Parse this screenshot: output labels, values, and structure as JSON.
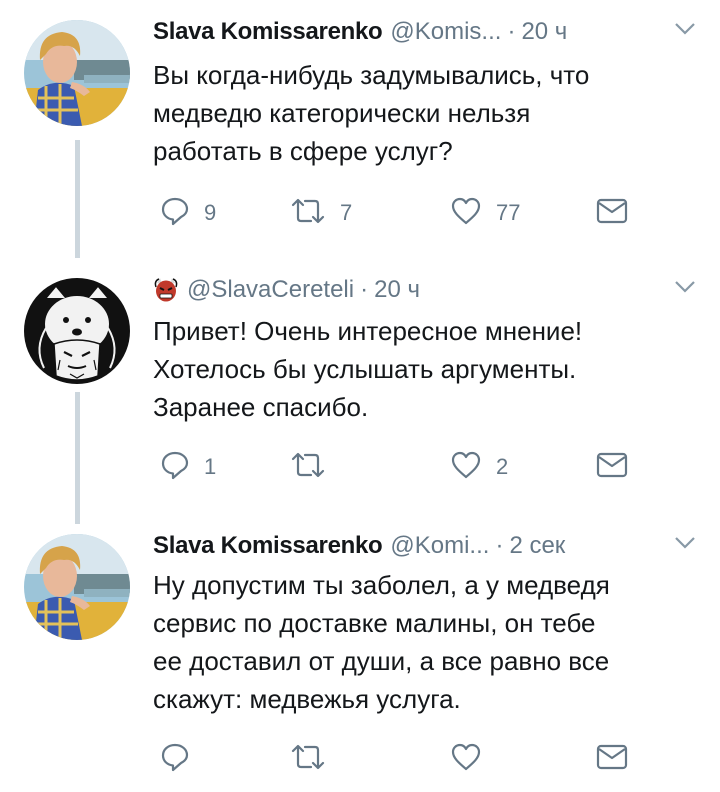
{
  "tweets": [
    {
      "name": "Slava Komissarenko",
      "handle": "@Komis...",
      "time": "20 ч",
      "lines": [
        "Вы когда-нибудь задумывались, что",
        "медведю категорически нельзя",
        "работать в сфере услуг?"
      ],
      "replies": "9",
      "retweets": "7",
      "likes": "77"
    },
    {
      "name": "",
      "handle": "@SlavaCereteli",
      "time": "20 ч",
      "lines": [
        "Привет! Очень интересное мнение!",
        "Хотелось бы услышать аргументы.",
        "Заранее спасибо."
      ],
      "replies": "1",
      "retweets": "",
      "likes": "2"
    },
    {
      "name": "Slava Komissarenko",
      "handle": "@Komi...",
      "time": "2 сек",
      "lines": [
        "Ну допустим ты заболел, а у медведя",
        "сервис по доставке малины, он тебе",
        "ее доставил от души, а все равно все",
        "скажут: медвежья услуга."
      ],
      "replies": "",
      "retweets": "",
      "likes": ""
    }
  ],
  "icons": {
    "reply": "reply-icon",
    "retweet": "retweet-icon",
    "like": "heart-icon",
    "dm": "envelope-icon",
    "more": "chevron-down-icon",
    "emoji": "oni-mask-emoji"
  },
  "colors": {
    "text": "#14171a",
    "secondary": "#657786",
    "thread": "#ccd6dd"
  }
}
